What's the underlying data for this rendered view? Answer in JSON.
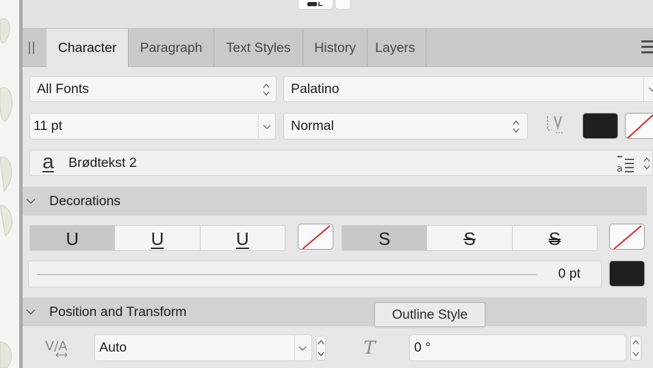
{
  "tabs": [
    "Character",
    "Paragraph",
    "Text Styles",
    "History",
    "Layers"
  ],
  "active_tab": "Character",
  "font_collection": "All Fonts",
  "font_family": "Palatino",
  "font_size": "11 pt",
  "font_style": "Normal",
  "paragraph_style": {
    "icon_glyph": "a",
    "name": "Brødtekst 2"
  },
  "sections": {
    "decorations": "Decorations",
    "position_transform": "Position and Transform"
  },
  "decorations": {
    "underline_options": [
      "U",
      "U",
      "U"
    ],
    "strikethrough_options": [
      "S",
      "S",
      "S"
    ],
    "line_weight": "0 pt"
  },
  "position": {
    "kerning_value": "Auto",
    "shear_value": "0 °"
  },
  "tooltip": "Outline Style",
  "colors": {
    "fill": "#1f1f1f",
    "none_slash": "#e0201f",
    "active_tab_bg": "#e6e6e6",
    "tab_bar_bg": "#c9c9c9"
  },
  "icons": [
    "paragraph-style-icon",
    "style-options-icon",
    "kerning-icon",
    "shear-icon",
    "hamburger-icon",
    "baseline-icon"
  ]
}
